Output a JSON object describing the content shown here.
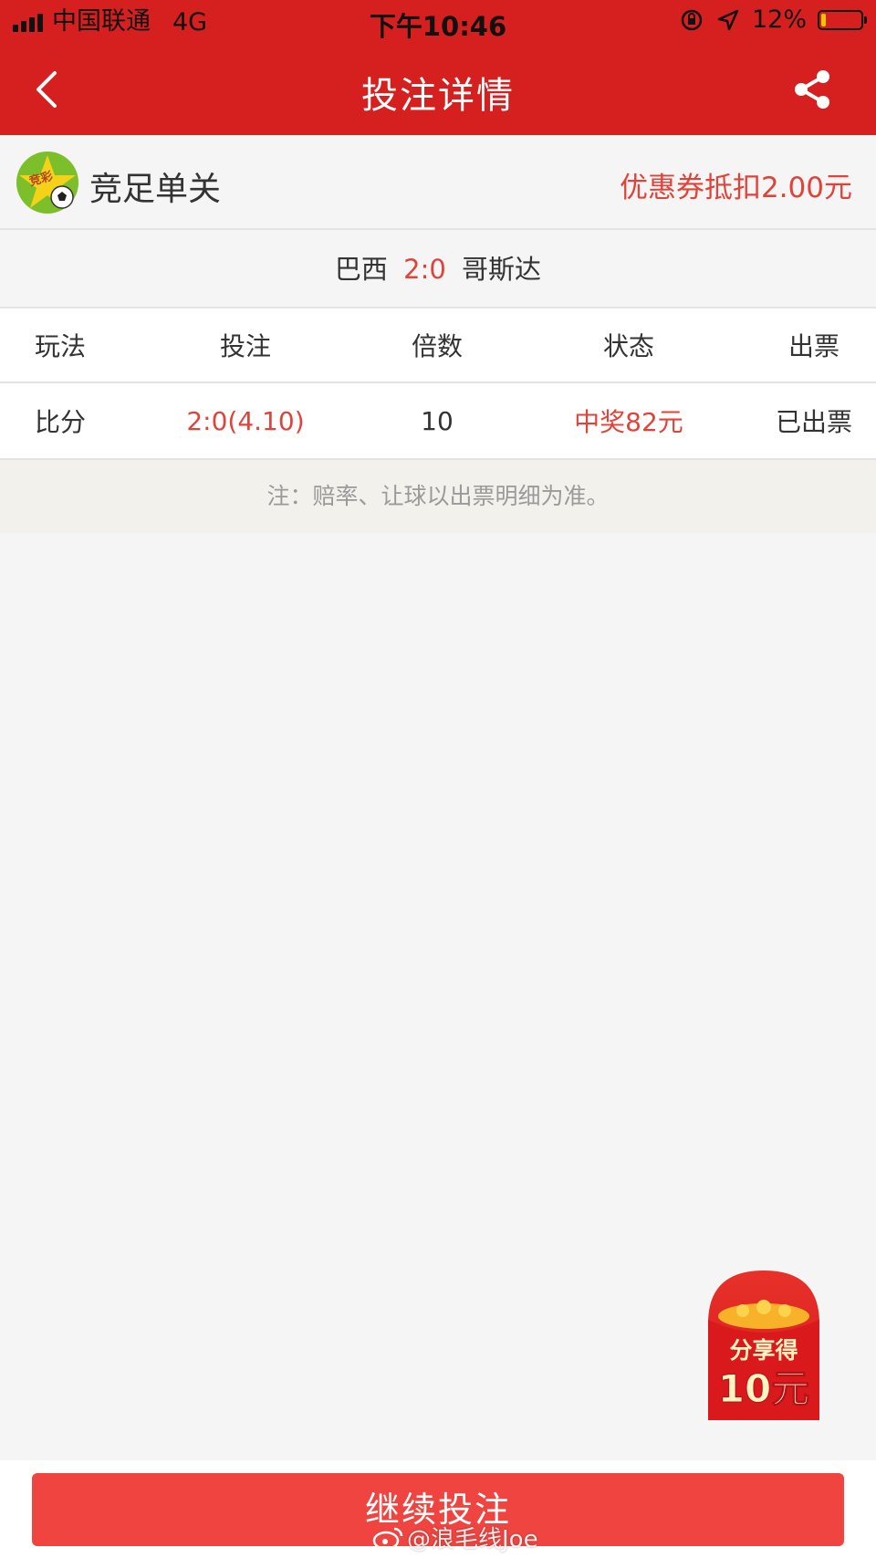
{
  "status_bar": {
    "carrier": "中国联通",
    "network": "4G",
    "time": "下午10:46",
    "battery": "12%",
    "battery_level": 0.12
  },
  "nav": {
    "title": "投注详情",
    "back_icon": "chevron-left-icon",
    "share_icon": "share-icon"
  },
  "lottery": {
    "name": "竞足单关",
    "coupon": "优惠券抵扣2.00元",
    "logo_icon": "jingcai-logo-icon",
    "logo_text": "竞彩"
  },
  "match": {
    "home": "巴西",
    "score": "2:0",
    "away": "哥斯达"
  },
  "table": {
    "headers": [
      "玩法",
      "投注",
      "倍数",
      "状态",
      "出票"
    ],
    "row": {
      "play": "比分",
      "bet": "2:0(4.10)",
      "multiple": "10",
      "status": "中奖82元",
      "ticket": "已出票"
    }
  },
  "note": "注：赔率、让球以出票明细为准。",
  "red_packet": {
    "line1": "分享得",
    "line2": "10元"
  },
  "bottom": {
    "button": "继续投注"
  },
  "watermark": "@浪毛线Joe",
  "colors": {
    "brand_red": "#d61f1f",
    "accent_red": "#e0433a",
    "button_red": "#ef4440"
  }
}
